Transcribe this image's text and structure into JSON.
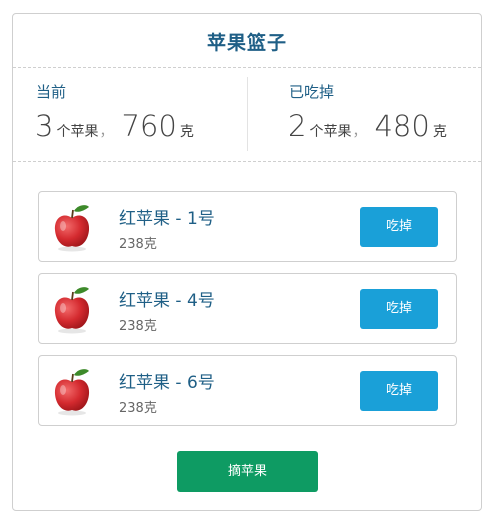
{
  "basket": {
    "title": "苹果篮子"
  },
  "current": {
    "label": "当前",
    "count": "3",
    "count_unit": "个苹果",
    "separator": "，",
    "weight": "760",
    "weight_unit": "克"
  },
  "eaten": {
    "label": "已吃掉",
    "count": "2",
    "count_unit": "个苹果",
    "separator": "，",
    "weight": "480",
    "weight_unit": "克"
  },
  "apples": [
    {
      "name": "红苹果 - 1号",
      "weight": "238克",
      "eat_label": "吃掉",
      "icon": "apple-icon"
    },
    {
      "name": "红苹果 - 4号",
      "weight": "238克",
      "eat_label": "吃掉",
      "icon": "apple-icon"
    },
    {
      "name": "红苹果 - 6号",
      "weight": "238克",
      "eat_label": "吃掉",
      "icon": "apple-icon"
    }
  ],
  "actions": {
    "pick_label": "摘苹果"
  },
  "colors": {
    "title": "#1f5f86",
    "eat_button": "#1aa0d8",
    "pick_button": "#0e9b63",
    "apple_red": "#d42a2f",
    "leaf_green": "#3d8a2a"
  }
}
